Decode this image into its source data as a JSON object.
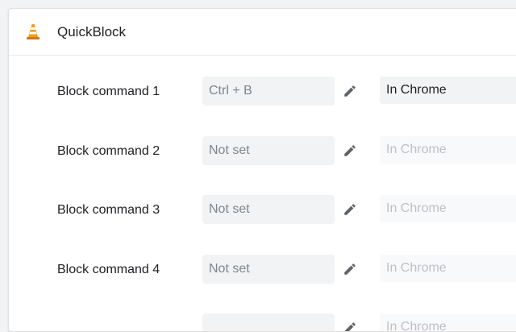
{
  "extension": {
    "name": "QuickBlock",
    "icon": "traffic-cone-icon"
  },
  "commands": [
    {
      "label": "Block command 1",
      "shortcut": "Ctrl + B",
      "scope": "In Chrome",
      "enabled": true
    },
    {
      "label": "Block command 2",
      "shortcut": "Not set",
      "scope": "In Chrome",
      "enabled": false
    },
    {
      "label": "Block command 3",
      "shortcut": "Not set",
      "scope": "In Chrome",
      "enabled": false
    },
    {
      "label": "Block command 4",
      "shortcut": "Not set",
      "scope": "In Chrome",
      "enabled": false
    },
    {
      "label": "",
      "shortcut": "",
      "scope": "In Chrome",
      "enabled": false
    }
  ],
  "colors": {
    "cone_orange": "#f29b1b",
    "text_primary": "#202124",
    "text_disabled": "#80868b"
  }
}
